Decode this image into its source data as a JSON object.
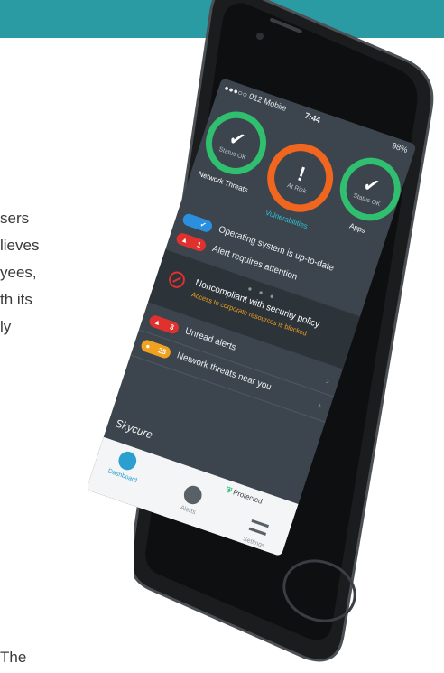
{
  "article": {
    "lines": [
      "sers",
      "lieves",
      "yees,",
      "th its",
      "ly",
      "The"
    ]
  },
  "status_bar": {
    "carrier": "●●●○○ 012 Mobile",
    "time": "7:44",
    "battery": "98%"
  },
  "gauges": [
    {
      "label": "Network Threats",
      "caption": "Status OK",
      "mark": "✓"
    },
    {
      "label": "Vulnerabilities",
      "caption": "At Risk",
      "mark": "!"
    },
    {
      "label": "Apps",
      "caption": "Status OK",
      "mark": "✓"
    }
  ],
  "rows": [
    {
      "text": "Operating system is up-to-date",
      "pill_left": "",
      "pill_right": "✓",
      "pill_color": "#2b8fe0"
    },
    {
      "text": "Alert requires attention",
      "pill_left": "▲",
      "pill_right": "1",
      "pill_color": "#e1312f"
    }
  ],
  "policy": {
    "title": "Noncompliant with security policy",
    "subtitle": "Access to corporate resources is blocked",
    "dots": "● ● ●"
  },
  "alerts": [
    {
      "text": "Unread alerts",
      "pill_left": "▲",
      "pill_right": "3",
      "pill_color": "#e1312f"
    },
    {
      "text": "Network threats near you",
      "pill_left": "●",
      "pill_right": "25",
      "pill_color": "#f0a120"
    }
  ],
  "brand": "Skycure",
  "tabbar": {
    "dashboard": "Dashboard",
    "alerts": "Alerts",
    "settings": "Settings",
    "protected": "Protected"
  },
  "colors": {
    "banner": "#2a9aa3",
    "ok": "#2fbf6e",
    "risk": "#f1661e",
    "accent": "#2dc2d6"
  }
}
